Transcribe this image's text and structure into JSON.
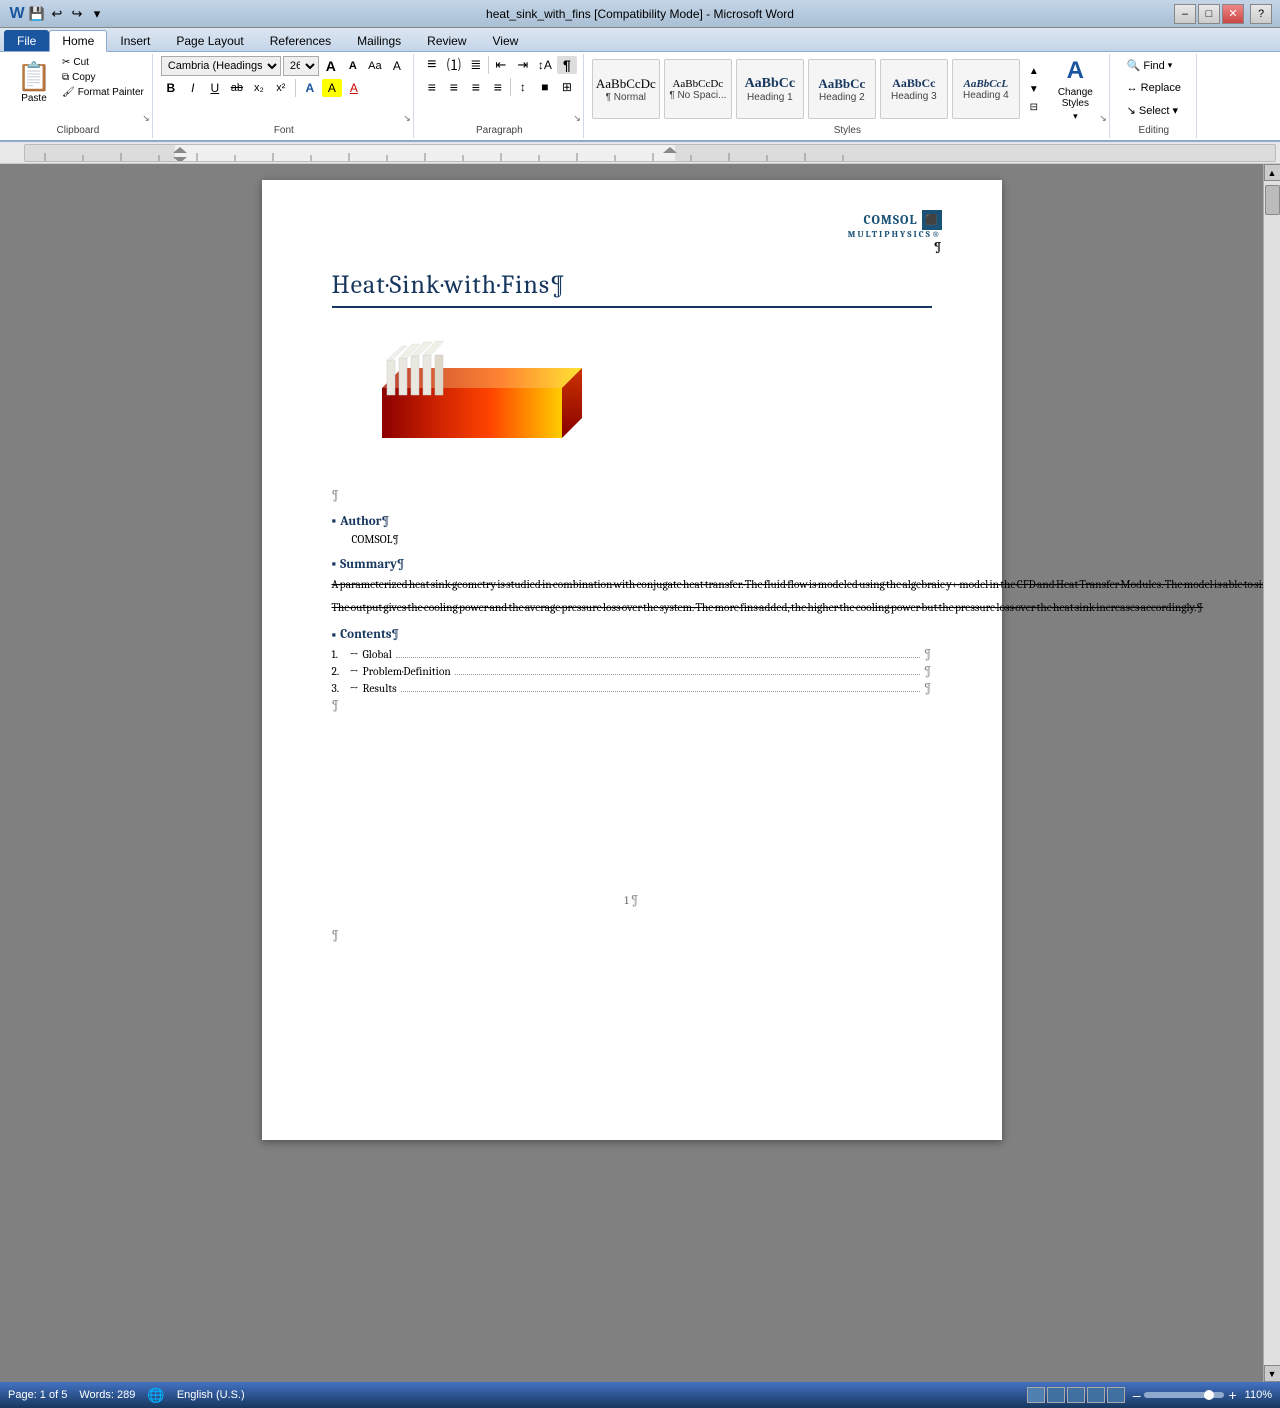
{
  "window": {
    "title": "heat_sink_with_fins [Compatibility Mode] - Microsoft Word",
    "min_label": "–",
    "max_label": "□",
    "close_label": "✕"
  },
  "quick_access": {
    "save_icon": "💾",
    "undo_icon": "↩",
    "redo_icon": "↪",
    "more_icon": "▾"
  },
  "ribbon": {
    "tabs": [
      {
        "label": "File",
        "active": false
      },
      {
        "label": "Home",
        "active": true
      },
      {
        "label": "Insert",
        "active": false
      },
      {
        "label": "Page Layout",
        "active": false
      },
      {
        "label": "References",
        "active": false
      },
      {
        "label": "Mailings",
        "active": false
      },
      {
        "label": "Review",
        "active": false
      },
      {
        "label": "View",
        "active": false
      }
    ],
    "clipboard": {
      "group_label": "Clipboard",
      "paste_label": "Paste",
      "cut_label": "Cut",
      "copy_label": "Copy",
      "format_painter_label": "Format Painter",
      "expand_icon": "↘"
    },
    "font": {
      "group_label": "Font",
      "font_name": "Cambria (Headings)",
      "font_size": "26",
      "grow_icon": "A",
      "shrink_icon": "A",
      "clear_icon": "A",
      "case_icon": "Aa",
      "bold_label": "B",
      "italic_label": "I",
      "underline_label": "U",
      "strikethrough_label": "ab",
      "subscript_label": "x₂",
      "superscript_label": "x²",
      "text_effects_label": "A",
      "text_highlight_label": "A",
      "font_color_label": "A",
      "expand_icon": "↘"
    },
    "paragraph": {
      "group_label": "Paragraph",
      "expand_icon": "↘"
    },
    "styles": {
      "group_label": "Styles",
      "items": [
        {
          "label": "¶ Normal",
          "preview": "AaBbCcDc",
          "active": false
        },
        {
          "label": "¶ No Spaci...",
          "preview": "AaBbCcDc",
          "active": false
        },
        {
          "label": "Heading 1",
          "preview": "AaBbCc",
          "active": false
        },
        {
          "label": "Heading 2",
          "preview": "AaBbCc",
          "active": false
        },
        {
          "label": "Heading 3",
          "preview": "AaBbCc",
          "active": false
        },
        {
          "label": "Heading 4",
          "preview": "AaBbCcL",
          "active": false
        }
      ],
      "change_styles_label": "Change Styles",
      "change_styles_icon": "A",
      "expand_icon": "↘"
    },
    "editing": {
      "group_label": "Editing",
      "find_label": "Find",
      "replace_label": "Replace",
      "select_label": "Select ▾",
      "find_icon": "🔍",
      "expand_icon": "↘"
    }
  },
  "document": {
    "comsol_logo_line1": "COMSOL",
    "comsol_logo_line2": "MULTIPHYSICS®",
    "pilcrow_title": "¶",
    "title": "Heat·Sink·with·Fins¶",
    "author_heading": "Author¶",
    "author_name": "COMSOL¶",
    "summary_heading": "Summary¶",
    "summary_p1": "A·parameterized·heat·sink·geometry·is·studied·in·combination·with·conjugate·heat·transfer.·The·fluid·flow·is·modeled·using·the·algebraic·y+·model·in·the·CFD·and·Heat·Transfer·Modules.·The·model·is·able·to·simulate·different·heat·sink·widths·and·fin·dimensions·at·a·given·cooling·air·velocity.·Also·the·number·of·fins·may·be·varied.¶",
    "summary_p2": "The·output·gives·the·cooling·power·and·the·average·pressure·loss·over·the·system.·The·more·fins·added,·the·higher·the·cooling·power·but·the·pressure·loss·over·the·heat·sink·increases·accordingly.¶",
    "contents_heading": "Contents¶",
    "contents_items": [
      {
        "num": "1.",
        "arrow": "→",
        "title": "Global",
        "page": "¶"
      },
      {
        "num": "2.",
        "arrow": "→",
        "title": "Problem·Definition",
        "page": "¶"
      },
      {
        "num": "3.",
        "arrow": "→",
        "title": "Results",
        "page": "¶"
      }
    ],
    "page_footer": "1¶",
    "bottom_pilcrow": "¶"
  },
  "status_bar": {
    "page_info": "Page: 1 of 5",
    "words_info": "Words: 289",
    "language": "English (U.S.)",
    "zoom_percent": "110%",
    "zoom_level": 110
  }
}
